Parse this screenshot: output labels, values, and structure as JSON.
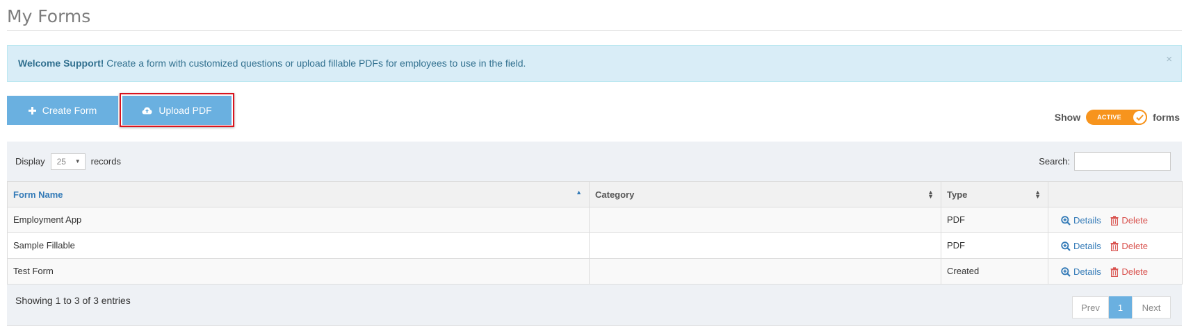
{
  "page": {
    "title": "My Forms"
  },
  "alert": {
    "strong": "Welcome Support!",
    "message": " Create a form with customized questions or upload fillable PDFs for employees to use in the field.",
    "close": "×"
  },
  "toolbar": {
    "create_label": "Create Form",
    "upload_label": "Upload PDF",
    "show_label": "Show",
    "toggle_label": "ACTIVE",
    "forms_label": "forms"
  },
  "controls": {
    "display_label": "Display",
    "page_size": "25",
    "records_label": "records",
    "search_label": "Search:",
    "search_value": ""
  },
  "table": {
    "columns": [
      "Form Name",
      "Category",
      "Type",
      ""
    ],
    "rows": [
      {
        "name": "Employment App",
        "category": "",
        "type": "PDF",
        "details": "Details",
        "delete": "Delete"
      },
      {
        "name": "Sample Fillable",
        "category": "",
        "type": "PDF",
        "details": "Details",
        "delete": "Delete"
      },
      {
        "name": "Test Form",
        "category": "",
        "type": "Created",
        "details": "Details",
        "delete": "Delete"
      }
    ]
  },
  "footer": {
    "info": "Showing 1 to 3 of 3 entries",
    "prev": "Prev",
    "page": "1",
    "next": "Next"
  },
  "colors": {
    "button": "#6ab0e0",
    "toggle": "#f7941d",
    "link": "#337ab7",
    "delete": "#d9534f",
    "alert_bg": "#d9edf7",
    "highlight": "#d9141f"
  }
}
